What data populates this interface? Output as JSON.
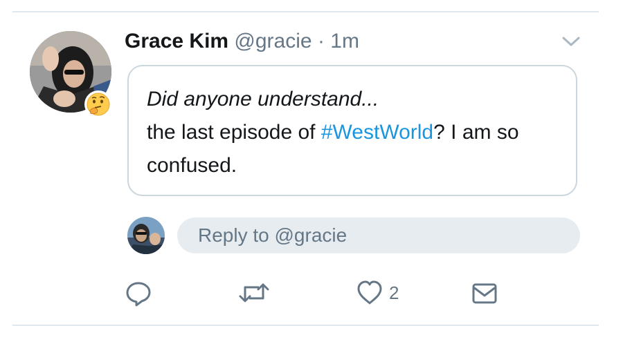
{
  "tweet": {
    "author_name": "Grace Kim",
    "handle": "@gracie",
    "separator": "·",
    "timestamp": "1m",
    "text_line1": "Did anyone understand...",
    "text_part1": "the last episode of ",
    "hashtag": "#WestWorld",
    "text_part2": "? I am so confused."
  },
  "reply": {
    "placeholder": "Reply to @gracie"
  },
  "actions": {
    "like_count": "2"
  },
  "icons": {
    "author_badge": "thinking-face-emoji",
    "menu": "chevron-down-icon",
    "reply": "reply-bubble-icon",
    "retweet": "retweet-icon",
    "like": "heart-icon",
    "dm": "envelope-icon"
  },
  "colors": {
    "link": "#1b95e0",
    "secondary_text": "#657786",
    "border": "#ccd6dd",
    "reply_bg": "#e6ecf0",
    "divider": "#e1e8ed"
  }
}
